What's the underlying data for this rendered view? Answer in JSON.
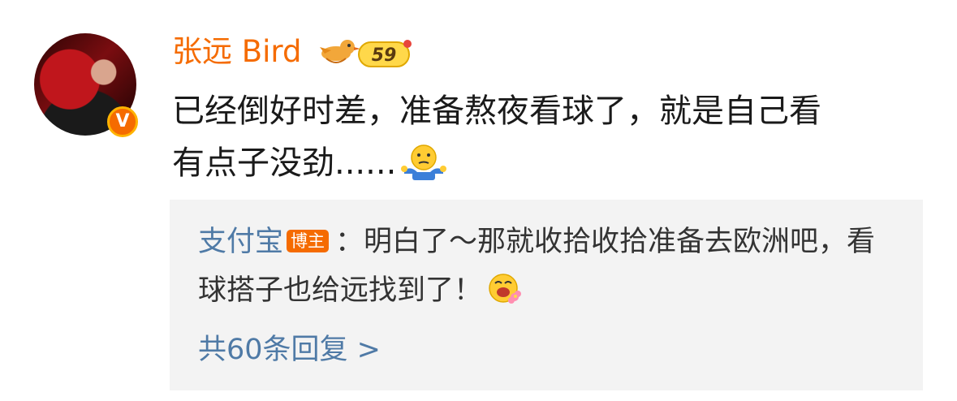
{
  "post": {
    "username": "张远 Bird",
    "level": "59",
    "comment_line1": "已经倒好时差，准备熬夜看球了，就是自己看",
    "comment_line2": "有点子没劲......",
    "comment_emoji": "shrug-emoji"
  },
  "reply": {
    "user": "支付宝",
    "op_badge": "博主",
    "separator": "：",
    "text": "明白了～那就收拾收拾准备去欧洲吧，看球搭子也给远找到了！",
    "emoji": "flower-laugh-emoji"
  },
  "more_replies": "共60条回复 >",
  "colors": {
    "username": "#f56b00",
    "link": "#4f7aa6",
    "reply_bg": "#f3f3f3"
  }
}
